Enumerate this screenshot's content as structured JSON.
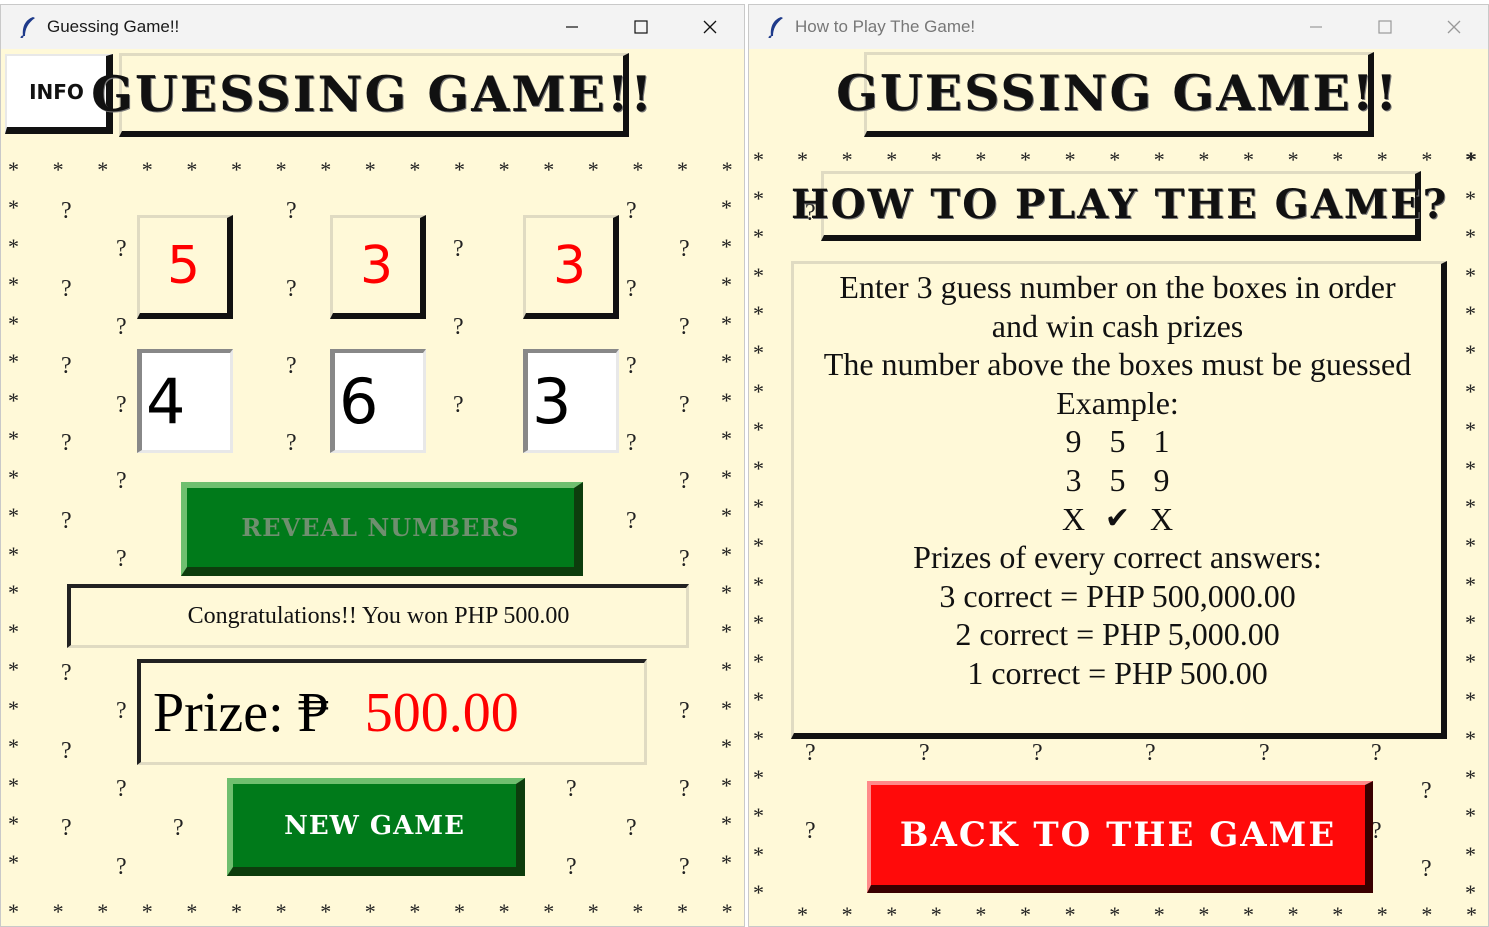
{
  "left_window": {
    "title": "Guessing Game!!",
    "info_button": "INFO",
    "game_title": "GUESSING GAME!!",
    "hidden_numbers": [
      "5",
      "3",
      "3"
    ],
    "guess_inputs": [
      "4",
      "6",
      "3"
    ],
    "reveal_button": "REVEAL NUMBERS",
    "message": "Congratulations!! You won PHP 500.00",
    "prize_label": "Prize: ₱",
    "prize_value": "500.00",
    "new_game_button": "NEW GAME"
  },
  "right_window": {
    "title": "How to Play The Game!",
    "game_title": "GUESSING GAME!!",
    "subtitle": "HOW TO PLAY THE GAME?",
    "instructions": {
      "line1": "Enter 3 guess number on the boxes in order",
      "line2": "and win cash prizes",
      "line3": "The number above the boxes must be guessed",
      "example_label": "Example:",
      "example_row1": [
        "9",
        "5",
        "1"
      ],
      "example_row2": [
        "3",
        "5",
        "9"
      ],
      "example_row3": [
        "X",
        "✔",
        "X"
      ],
      "prizes_label": "Prizes of every correct answers:",
      "prize3": "3 correct = PHP 500,000.00",
      "prize2": "2 correct = PHP 5,000.00",
      "prize1": "1 correct = PHP 500.00"
    },
    "back_button": "BACK TO THE GAME"
  },
  "colors": {
    "background": "#fff9d8",
    "green_button": "#007a1a",
    "red_button": "#ff0a0a",
    "hidden_number": "#ff0000",
    "prize_value": "#ff0000",
    "reveal_text": "#6f8f6f"
  },
  "icons": [
    "feather-icon",
    "minimize-icon",
    "maximize-icon",
    "close-icon"
  ]
}
